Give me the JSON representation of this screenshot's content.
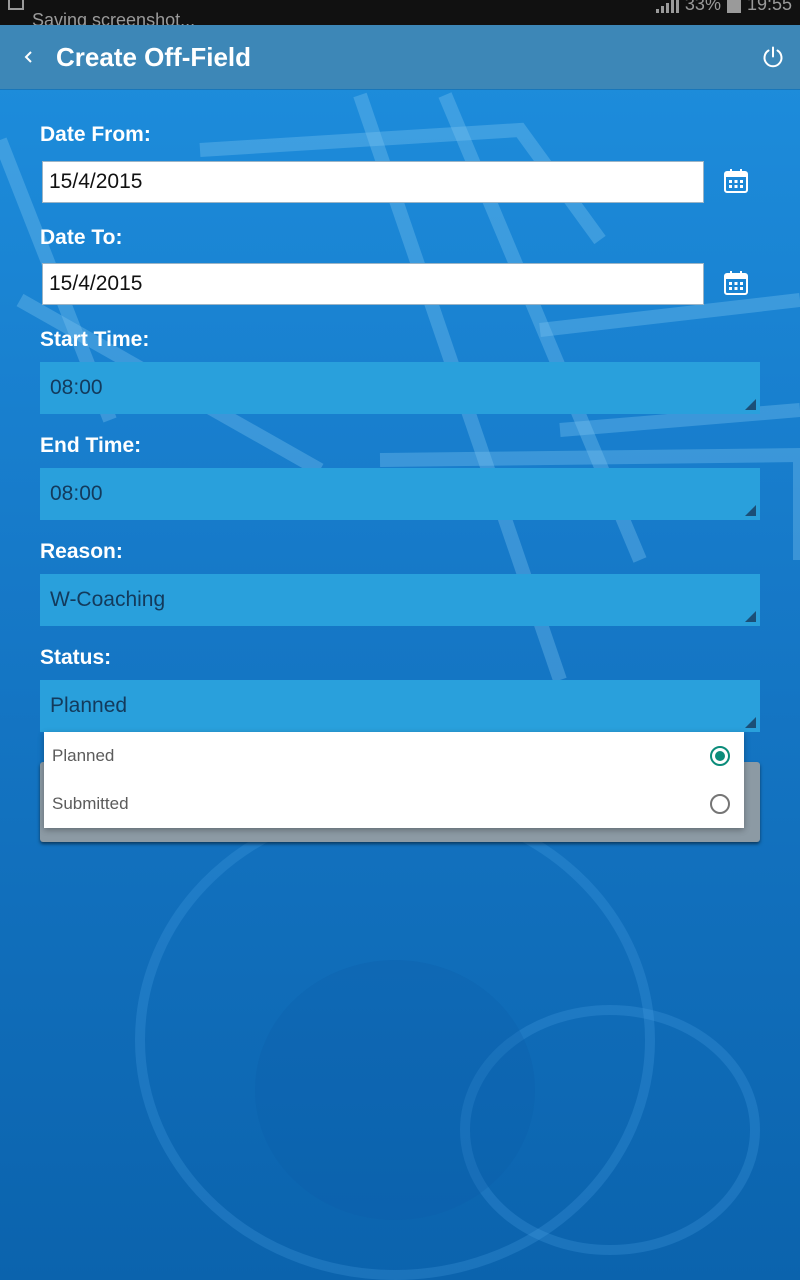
{
  "statusbar": {
    "notification": "Saving screenshot...",
    "battery": "33%",
    "time": "19:55"
  },
  "actionbar": {
    "back_icon": "chevron-left-icon",
    "title": "Create Off-Field",
    "power_icon": "power-icon"
  },
  "form": {
    "date_from": {
      "label": "Date From:",
      "value": "15/4/2015",
      "icon": "calendar-icon"
    },
    "date_to": {
      "label": "Date To:",
      "value": "15/4/2015",
      "icon": "calendar-icon"
    },
    "start_time": {
      "label": "Start Time:",
      "value": "08:00"
    },
    "end_time": {
      "label": "End Time:",
      "value": "08:00"
    },
    "reason": {
      "label": "Reason:",
      "value": "W-Coaching"
    },
    "status": {
      "label": "Status:",
      "value": "Planned"
    }
  },
  "status_dropdown": {
    "options": [
      {
        "label": "Planned",
        "selected": true
      },
      {
        "label": "Submitted",
        "selected": false
      }
    ]
  },
  "colors": {
    "actionbar": "#3d87b7",
    "spinner": "#29a0dc",
    "radio_selected": "#0b8c7a"
  }
}
